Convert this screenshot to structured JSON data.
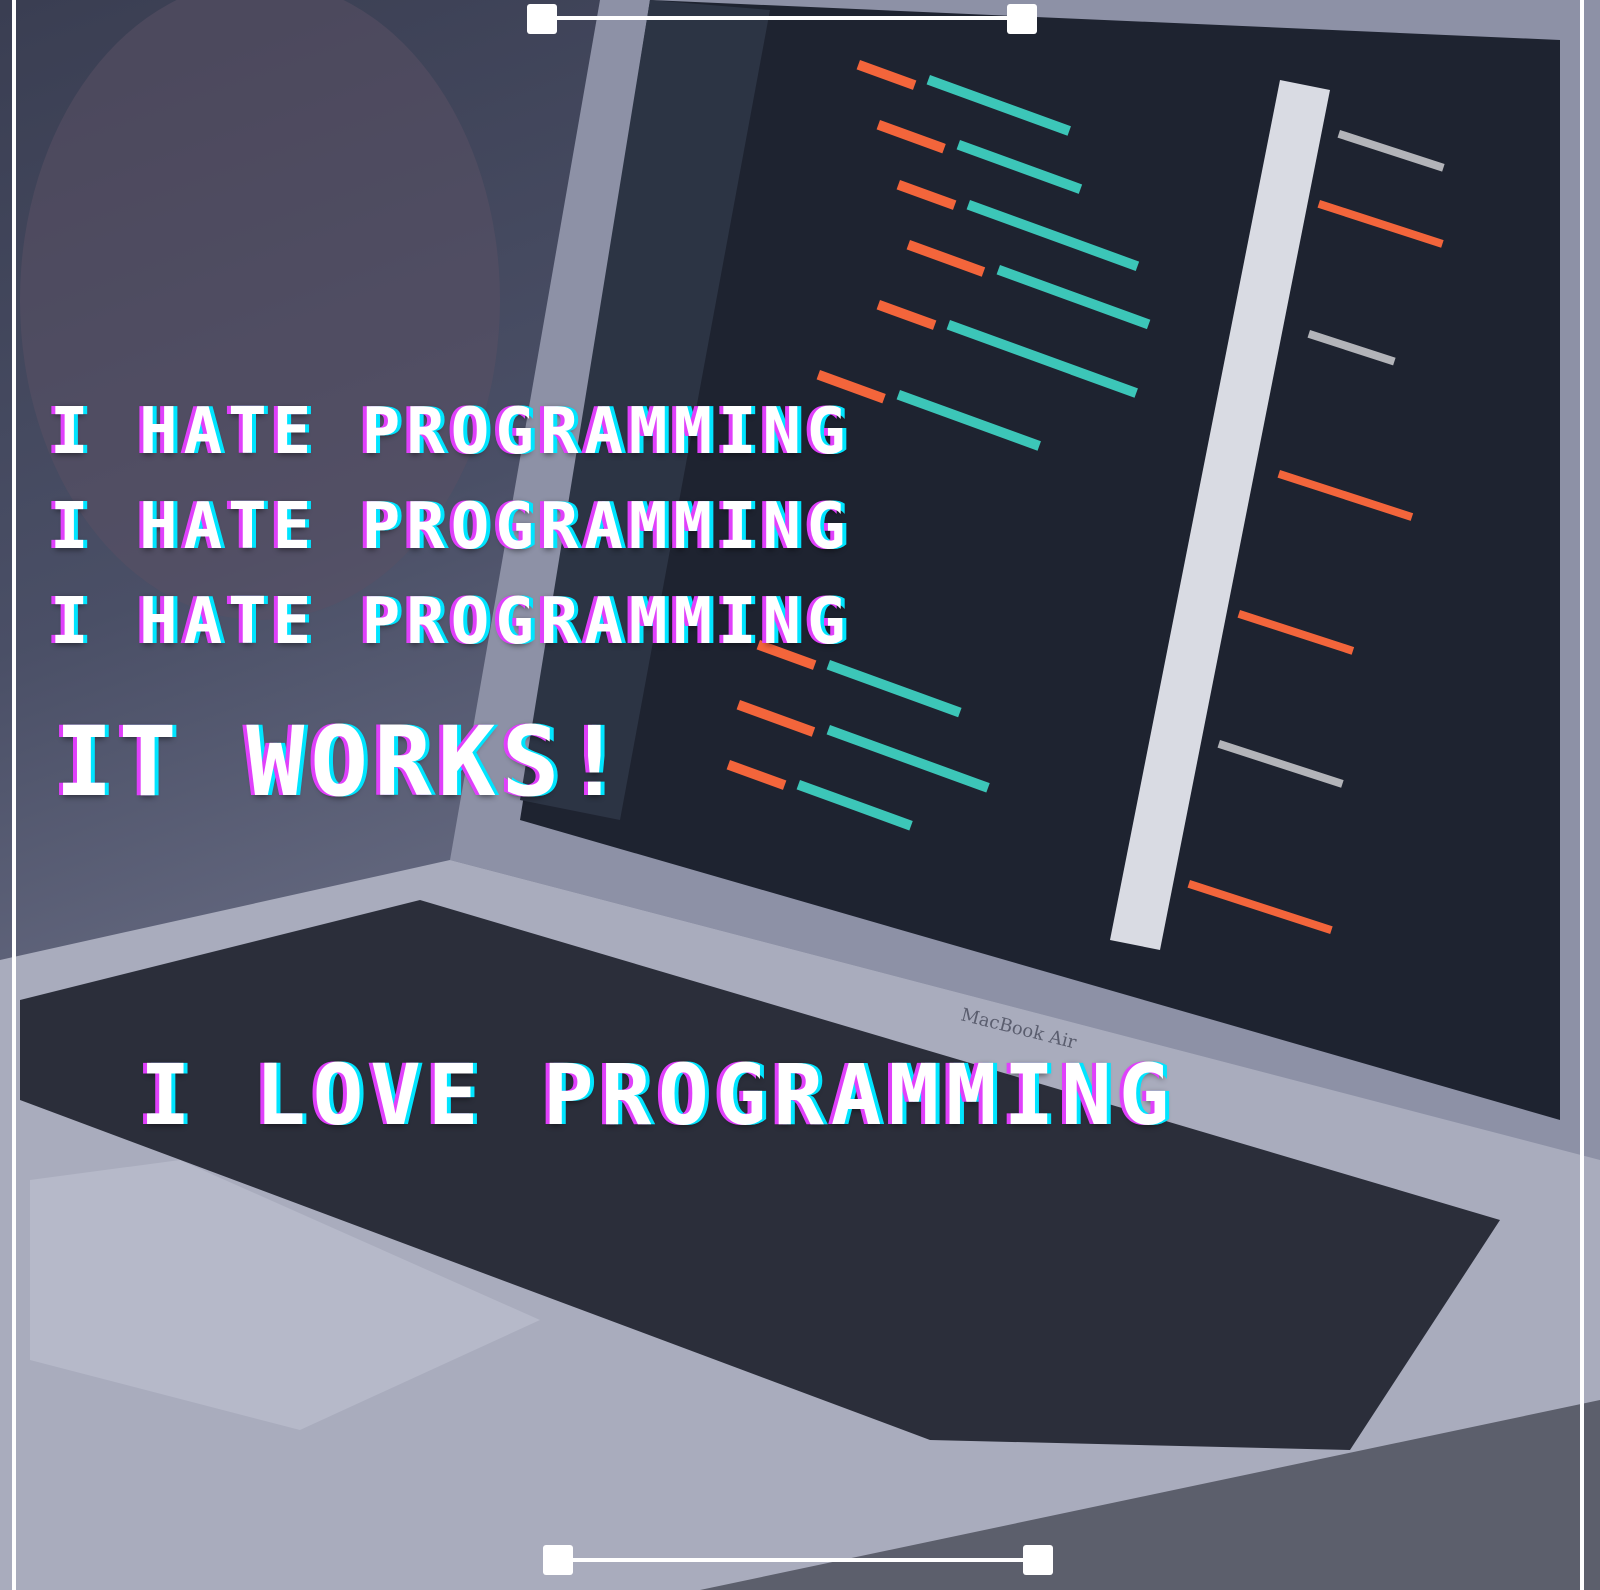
{
  "meme": {
    "hate_lines": [
      "I HATE PROGRAMMING",
      "I HATE PROGRAMMING",
      "I HATE PROGRAMMING"
    ],
    "works_line": "IT WORKS!",
    "love_line": "I LOVE PROGRAMMING"
  },
  "laptop": {
    "brand_text": "MacBook Air"
  },
  "colors": {
    "text": "#ffffff",
    "glitch_magenta": "#e040fb",
    "glitch_cyan": "#00e5ff",
    "code_orange": "#ff6a3d",
    "code_teal": "#3fd0c0",
    "screen_dark": "#1e2330"
  }
}
